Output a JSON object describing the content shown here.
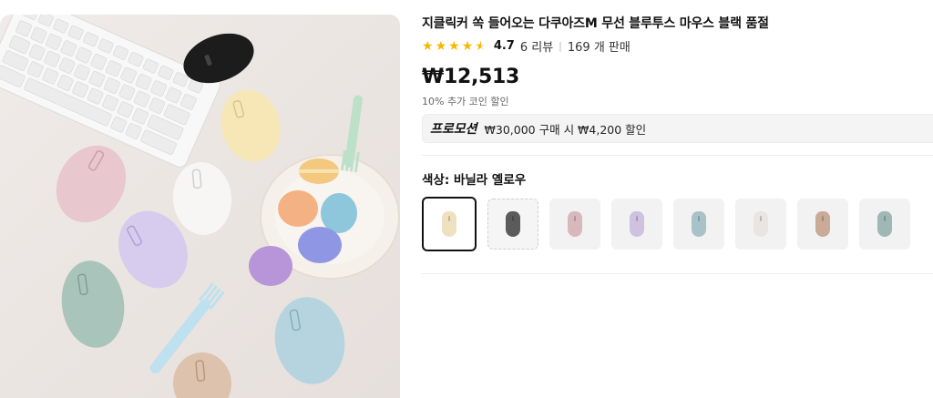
{
  "product": {
    "title": "지클릭커 쏙 들어오는 다쿠아즈M 무선 블루투스 마우스 블랙 품절",
    "rating": "4.7",
    "rating_stars": 4.5,
    "review_count_text": "6 리뷰",
    "sold_text": "169 개 판매",
    "price": "₩12,513",
    "coin_discount": "10% 추가 코인 할인"
  },
  "promotion": {
    "badge": "프로모션",
    "text": "₩30,000 구매 시 ₩4,200 할인"
  },
  "color_option": {
    "label": "색상: 바닐라 옐로우",
    "swatches": [
      {
        "color": "#efe1c0",
        "state": "selected"
      },
      {
        "color": "#5b5b5b",
        "state": "soldout"
      },
      {
        "color": "#d9b8bd",
        "state": "normal"
      },
      {
        "color": "#cfc1e0",
        "state": "normal"
      },
      {
        "color": "#a9c1c8",
        "state": "normal"
      },
      {
        "color": "#e9e5e1",
        "state": "normal"
      },
      {
        "color": "#c9ab97",
        "state": "normal"
      },
      {
        "color": "#9fb7b5",
        "state": "normal"
      }
    ]
  },
  "colors": {
    "star": "#f5b800",
    "text_primary": "#111111"
  }
}
